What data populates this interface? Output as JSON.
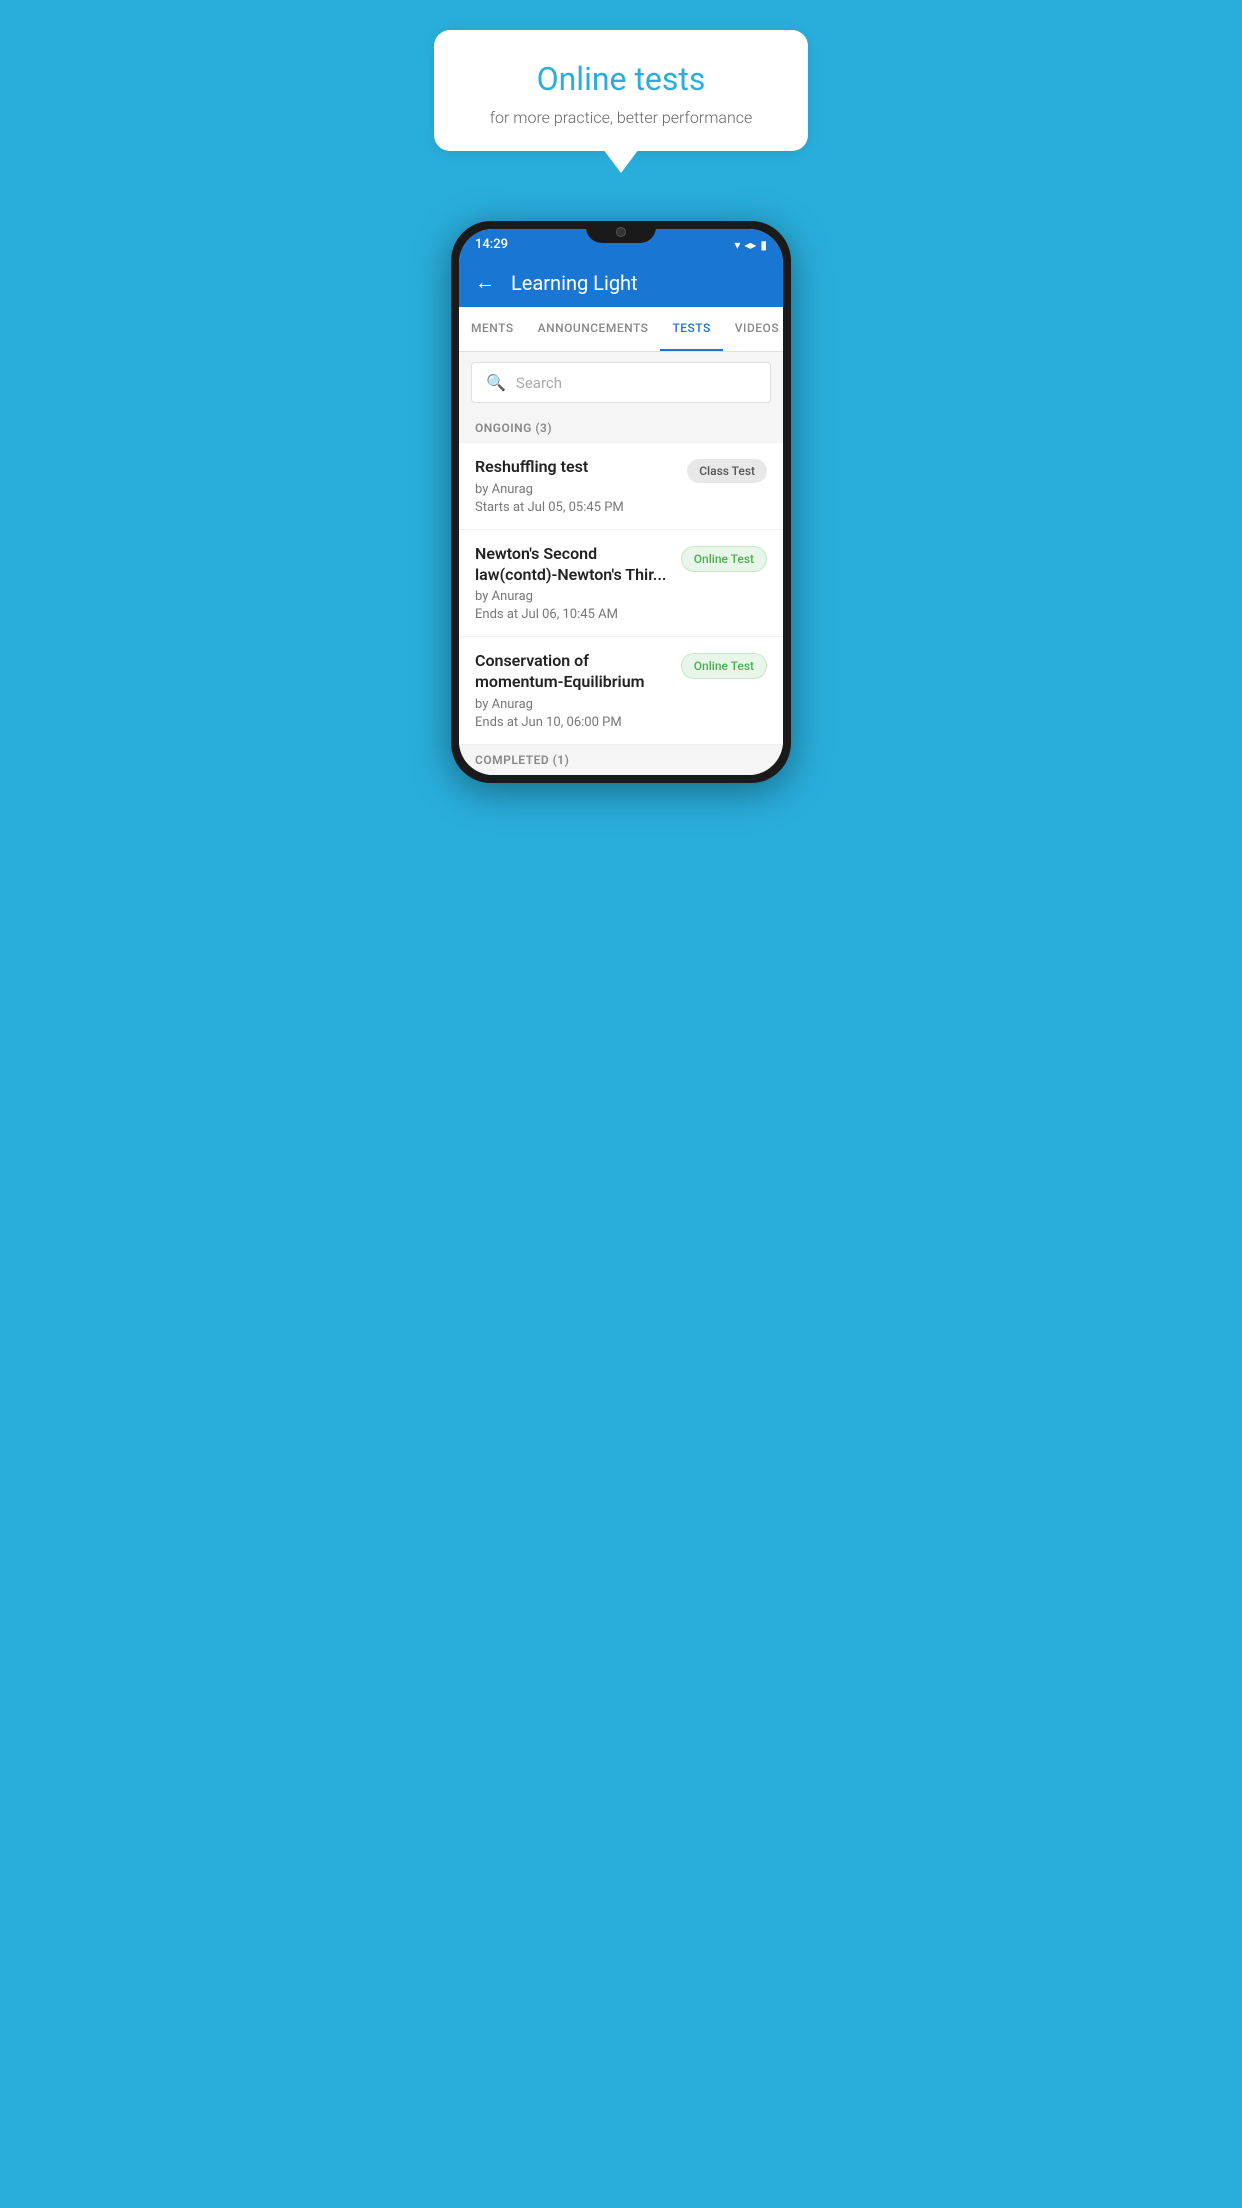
{
  "background_color": "#29AEDC",
  "speech_bubble": {
    "title": "Online tests",
    "subtitle": "for more practice, better performance"
  },
  "phone": {
    "status_bar": {
      "time": "14:29",
      "icons": [
        "▼",
        "◀",
        "▌"
      ]
    },
    "app_header": {
      "back_label": "←",
      "title": "Learning Light"
    },
    "tabs": [
      {
        "label": "MENTS",
        "active": false
      },
      {
        "label": "ANNOUNCEMENTS",
        "active": false
      },
      {
        "label": "TESTS",
        "active": true
      },
      {
        "label": "VIDEOS",
        "active": false
      }
    ],
    "search": {
      "placeholder": "Search",
      "icon": "🔍"
    },
    "sections": [
      {
        "label": "ONGOING (3)",
        "items": [
          {
            "name": "Reshuffling test",
            "author": "by Anurag",
            "date": "Starts at  Jul 05, 05:45 PM",
            "badge": "Class Test",
            "badge_type": "class"
          },
          {
            "name": "Newton's Second law(contd)-Newton's Thir...",
            "author": "by Anurag",
            "date": "Ends at  Jul 06, 10:45 AM",
            "badge": "Online Test",
            "badge_type": "online"
          },
          {
            "name": "Conservation of momentum-Equilibrium",
            "author": "by Anurag",
            "date": "Ends at  Jun 10, 06:00 PM",
            "badge": "Online Test",
            "badge_type": "online"
          }
        ]
      },
      {
        "label": "COMPLETED (1)",
        "items": []
      }
    ]
  }
}
